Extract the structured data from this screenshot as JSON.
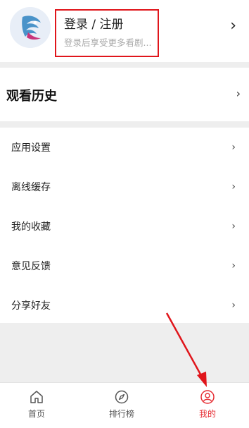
{
  "profile": {
    "login_title": "登录 / 注册",
    "login_subtitle": "登录后享受更多看剧...",
    "avatar_icon": "app-logo-icon",
    "chevron": "›",
    "highlight_color": "#e0151b"
  },
  "history": {
    "title": "观看历史",
    "chevron": "›"
  },
  "menu": {
    "items": [
      {
        "label": "应用设置",
        "chevron": "›"
      },
      {
        "label": "离线缓存",
        "chevron": "›"
      },
      {
        "label": "我的收藏",
        "chevron": "›"
      },
      {
        "label": "意见反馈",
        "chevron": "›"
      },
      {
        "label": "分享好友",
        "chevron": "›"
      }
    ]
  },
  "tabbar": {
    "tabs": [
      {
        "label": "首页",
        "icon": "home-icon",
        "active": false
      },
      {
        "label": "排行榜",
        "icon": "compass-icon",
        "active": false
      },
      {
        "label": "我的",
        "icon": "user-icon",
        "active": true
      }
    ],
    "active_color": "#e62b31"
  },
  "annotation": {
    "arrow_color": "#e0151b"
  }
}
